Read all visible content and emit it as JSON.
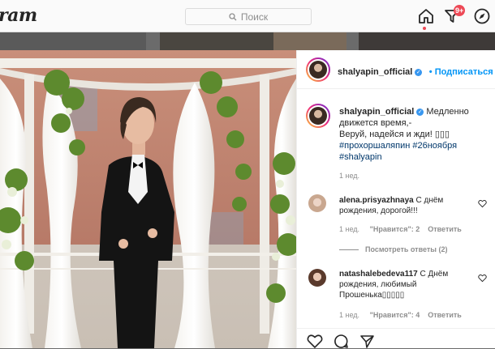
{
  "nav": {
    "logo": "ram",
    "search_placeholder": "Поиск",
    "activity_badge": "9+",
    "icons": [
      "home-icon",
      "activity-icon",
      "explore-icon"
    ]
  },
  "post": {
    "author": "shalyapin_official",
    "follow_label": "Подписаться",
    "caption": {
      "username": "shalyapin_official",
      "line1": "Медленно движется время,-",
      "line2": "Веруй, надейся и жди! ▯▯▯",
      "hashtags": "#прохоршаляпин #26ноября #shalyapin",
      "time": "1 нед."
    },
    "comments": [
      {
        "username": "alena.prisyazhnaya",
        "text": "С днём рождения, дорогой!!!",
        "time": "1 нед.",
        "likes": "\"Нравится\": 2",
        "reply": "Ответить",
        "view_replies": "Посмотреть ответы (2)"
      },
      {
        "username": "natashalebedeva117",
        "text": "С Днём рождения, любимый Прошенька▯▯▯▯▯",
        "time": "1 нед.",
        "likes": "\"Нравится\": 4",
        "reply": "Ответить"
      }
    ],
    "actions": [
      "like-icon",
      "comment-icon",
      "share-icon"
    ]
  },
  "colors": {
    "accent": "#0095f6",
    "badge": "#ed4956",
    "verified": "#3897f0"
  }
}
